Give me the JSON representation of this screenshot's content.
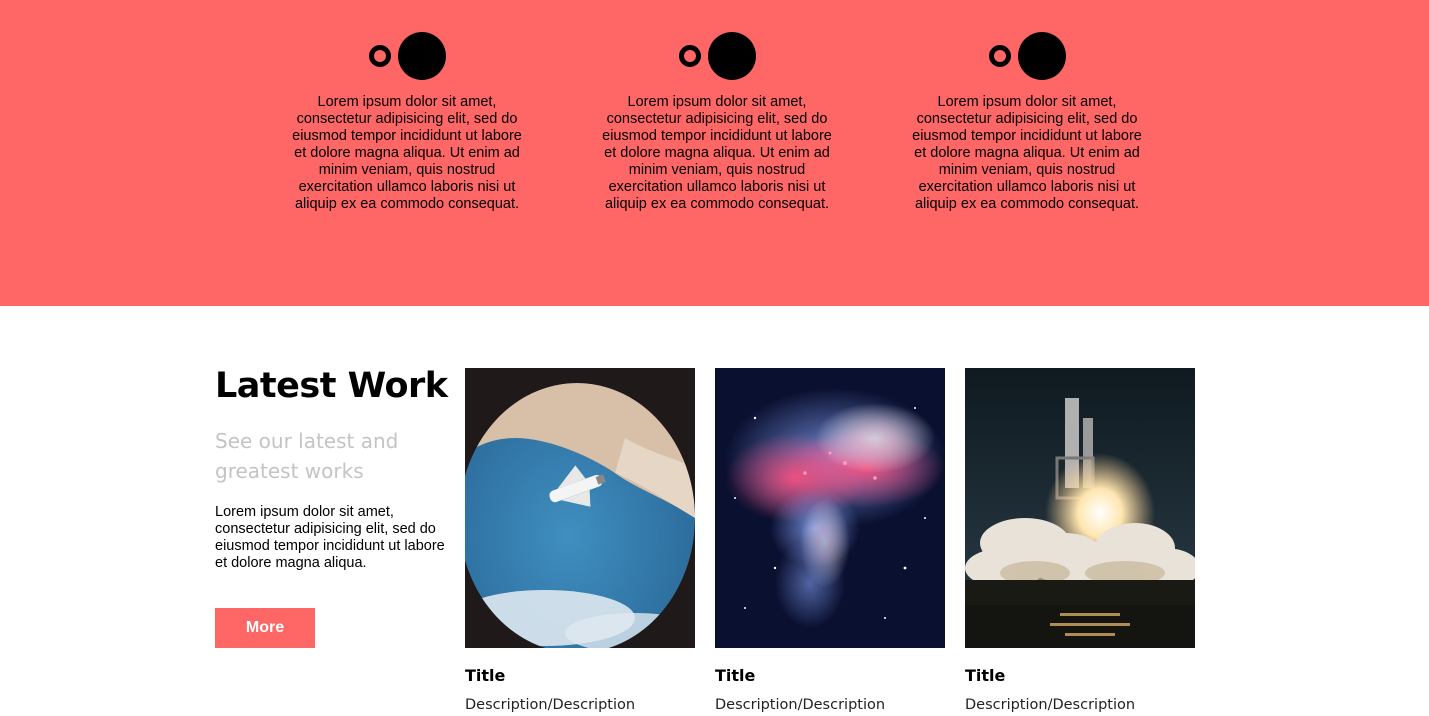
{
  "features": [
    {
      "text": "Lorem ipsum dolor sit amet, consectetur adipisicing elit, sed do eiusmod tempor incididunt ut labore et dolore magna aliqua. Ut enim ad minim veniam, quis nostrud exercitation ullamco laboris nisi ut aliquip ex ea commodo consequat."
    },
    {
      "text": "Lorem ipsum dolor sit amet, consectetur adipisicing elit, sed do eiusmod tempor incididunt ut labore et dolore magna aliqua. Ut enim ad minim veniam, quis nostrud exercitation ullamco laboris nisi ut aliquip ex ea commodo consequat."
    },
    {
      "text": "Lorem ipsum dolor sit amet, consectetur adipisicing elit, sed do eiusmod tempor incididunt ut labore et dolore magna aliqua. Ut enim ad minim veniam, quis nostrud exercitation ullamco laboris nisi ut aliquip ex ea commodo consequat."
    }
  ],
  "latest": {
    "heading": "Latest Work",
    "subheading": "See our latest and greatest works",
    "body": "Lorem ipsum dolor sit amet, consectetur adipisicing elit, sed do eiusmod tempor incididunt ut labore et dolore magna aliqua.",
    "more_label": "More",
    "items": [
      {
        "title": "Title",
        "description": "Description/Description"
      },
      {
        "title": "Title",
        "description": "Description/Description"
      },
      {
        "title": "Title",
        "description": "Description/Description"
      }
    ]
  },
  "colors": {
    "accent": "#ff6666",
    "subheading": "#c4c4c4",
    "text": "#000000"
  }
}
